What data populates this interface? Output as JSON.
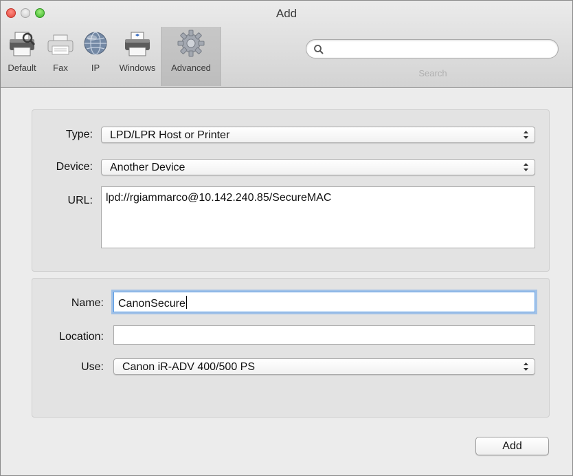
{
  "window": {
    "title": "Add"
  },
  "toolbar": {
    "items": [
      {
        "label": "Default",
        "icon": "default-printer-icon"
      },
      {
        "label": "Fax",
        "icon": "fax-icon"
      },
      {
        "label": "IP",
        "icon": "ip-globe-icon"
      },
      {
        "label": "Windows",
        "icon": "windows-printer-icon"
      },
      {
        "label": "Advanced",
        "icon": "gear-icon",
        "selected": true
      }
    ],
    "search_label": "Search",
    "search_value": ""
  },
  "connection": {
    "type_label": "Type:",
    "type_value": "LPD/LPR Host or Printer",
    "device_label": "Device:",
    "device_value": "Another Device",
    "url_label": "URL:",
    "url_value": "lpd://rgiammarco@10.142.240.85/SecureMAC"
  },
  "printer": {
    "name_label": "Name:",
    "name_value": "CanonSecure",
    "location_label": "Location:",
    "location_value": "",
    "use_label": "Use:",
    "use_value": "Canon iR-ADV 400/500 PS"
  },
  "actions": {
    "add_label": "Add"
  },
  "colors": {
    "focus_ring": "#6ca5eb",
    "close": "#e0443a",
    "zoom": "#3cb12a"
  }
}
